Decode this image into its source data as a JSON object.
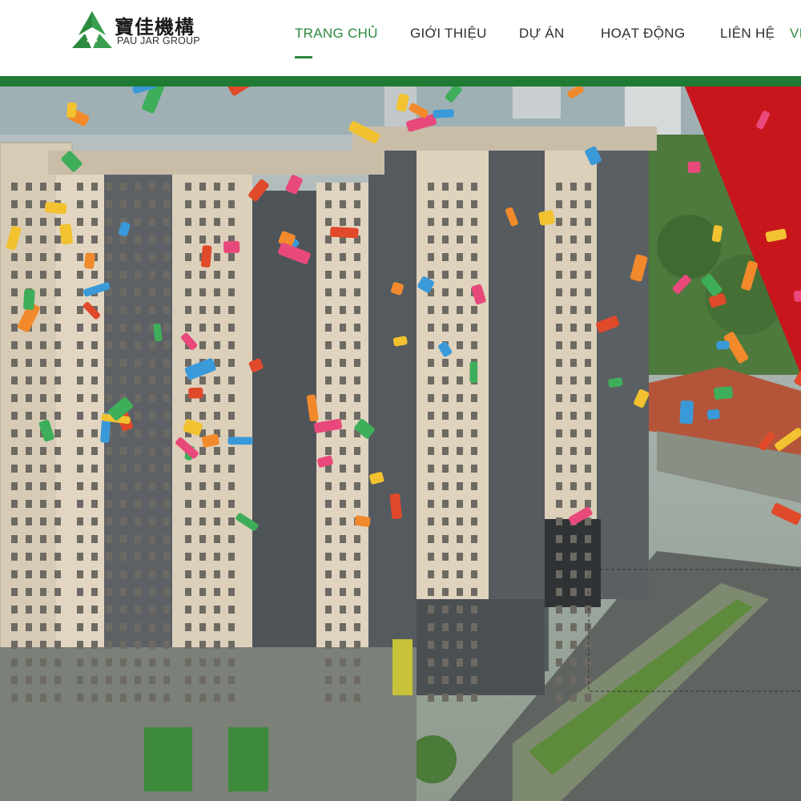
{
  "brand": {
    "name_cn": "寶佳機構",
    "name_en": "PAU JAR GROUP",
    "colors": {
      "primary_green": "#2b8a3e",
      "bar_green": "#1f7a34",
      "banner_red": "#c8161d"
    }
  },
  "nav": {
    "items": [
      {
        "label": "TRANG CHỦ",
        "active": true
      },
      {
        "label": "GIỚI THIỆU",
        "active": false
      },
      {
        "label": "DỰ ÁN",
        "active": false
      },
      {
        "label": "HOẠT ĐỘNG",
        "active": false
      },
      {
        "label": "LIÊN HỆ",
        "active": false
      },
      {
        "label": "VI",
        "active": false
      }
    ]
  },
  "hero": {
    "icon": "hero-photo-apartment-towers-with-confetti"
  }
}
